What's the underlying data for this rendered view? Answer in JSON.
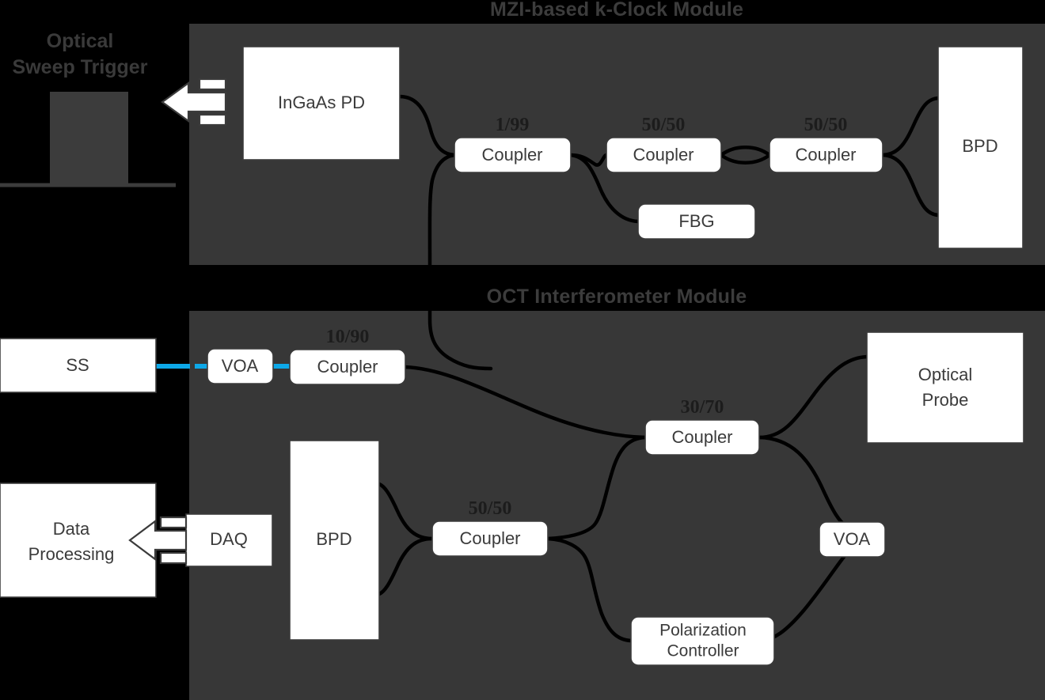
{
  "figure": {
    "background_color": "#000000",
    "panel_color": "#373737",
    "box_fill": "#ffffff",
    "box_stroke": "#3b3b3b",
    "fiber_color": "#000000",
    "source_link_color": "#0da8e8",
    "title_color": "#3c3c3c"
  },
  "modules": [
    {
      "id": "kclock",
      "title": "MZI-based k-Clock Module"
    },
    {
      "id": "oct",
      "title": "OCT Interferometer Module"
    }
  ],
  "trigger_panel": {
    "heading_line1": "Optical",
    "heading_line2": "Sweep Trigger",
    "waveform_type": "square-pulse"
  },
  "kclock_module": {
    "blocks": [
      {
        "id": "ingaas-pd",
        "label": "InGaAs PD",
        "shape": "rect"
      },
      {
        "id": "coupler-1-99",
        "label": "Coupler",
        "shape": "rounded",
        "ratio": "1/99"
      },
      {
        "id": "coupler-50-50-a",
        "label": "Coupler",
        "shape": "rounded",
        "ratio": "50/50"
      },
      {
        "id": "coupler-50-50-b",
        "label": "Coupler",
        "shape": "rounded",
        "ratio": "50/50"
      },
      {
        "id": "fbg",
        "label": "FBG",
        "shape": "rounded"
      },
      {
        "id": "bpd-top",
        "label": "BPD",
        "shape": "rect"
      }
    ]
  },
  "oct_module": {
    "blocks": [
      {
        "id": "ss",
        "label": "SS",
        "shape": "rect"
      },
      {
        "id": "voa-in",
        "label": "VOA",
        "shape": "rounded"
      },
      {
        "id": "coupler-10-90",
        "label": "Coupler",
        "shape": "rounded",
        "ratio": "10/90"
      },
      {
        "id": "coupler-30-70",
        "label": "Coupler",
        "shape": "rounded",
        "ratio": "30/70"
      },
      {
        "id": "optical-probe",
        "label_line1": "Optical",
        "label_line2": "Probe",
        "shape": "rect"
      },
      {
        "id": "voa-ref",
        "label": "VOA",
        "shape": "rounded"
      },
      {
        "id": "polarization-controller",
        "label_line1": "Polarization",
        "label_line2": "Controller",
        "shape": "rounded"
      },
      {
        "id": "coupler-50-50-c",
        "label": "Coupler",
        "shape": "rounded",
        "ratio": "50/50"
      },
      {
        "id": "bpd-bottom",
        "label": "BPD",
        "shape": "rect"
      },
      {
        "id": "daq",
        "label": "DAQ",
        "shape": "rect"
      },
      {
        "id": "data-processing",
        "label_line1": "Data",
        "label_line2": "Processing",
        "shape": "rect"
      }
    ]
  },
  "connectors": [
    {
      "from": "ingaas-pd",
      "to": "coupler-1-99",
      "type": "fiber"
    },
    {
      "from": "coupler-1-99",
      "to": "coupler-50-50-a",
      "type": "fiber"
    },
    {
      "from": "coupler-1-99",
      "to": "coupler-10-90",
      "type": "fiber"
    },
    {
      "from": "coupler-50-50-a",
      "to": "fbg",
      "type": "fiber"
    },
    {
      "from": "coupler-50-50-a",
      "to": "coupler-50-50-b",
      "type": "fiber-loop"
    },
    {
      "from": "coupler-50-50-b",
      "to": "bpd-top",
      "type": "fiber"
    },
    {
      "from": "ss",
      "to": "voa-in",
      "type": "source-link"
    },
    {
      "from": "voa-in",
      "to": "coupler-10-90",
      "type": "source-link"
    },
    {
      "from": "coupler-10-90",
      "to": "coupler-30-70",
      "type": "fiber"
    },
    {
      "from": "coupler-30-70",
      "to": "optical-probe",
      "type": "fiber"
    },
    {
      "from": "coupler-30-70",
      "to": "voa-ref",
      "type": "fiber"
    },
    {
      "from": "voa-ref",
      "to": "polarization-controller",
      "type": "fiber"
    },
    {
      "from": "polarization-controller",
      "to": "coupler-50-50-c",
      "type": "fiber"
    },
    {
      "from": "coupler-30-70",
      "to": "coupler-50-50-c",
      "type": "fiber"
    },
    {
      "from": "coupler-50-50-c",
      "to": "bpd-bottom",
      "type": "fiber"
    },
    {
      "from": "bpd-top",
      "to": "trigger",
      "type": "block-arrow"
    },
    {
      "from": "daq",
      "to": "data-processing",
      "type": "block-arrow"
    }
  ]
}
